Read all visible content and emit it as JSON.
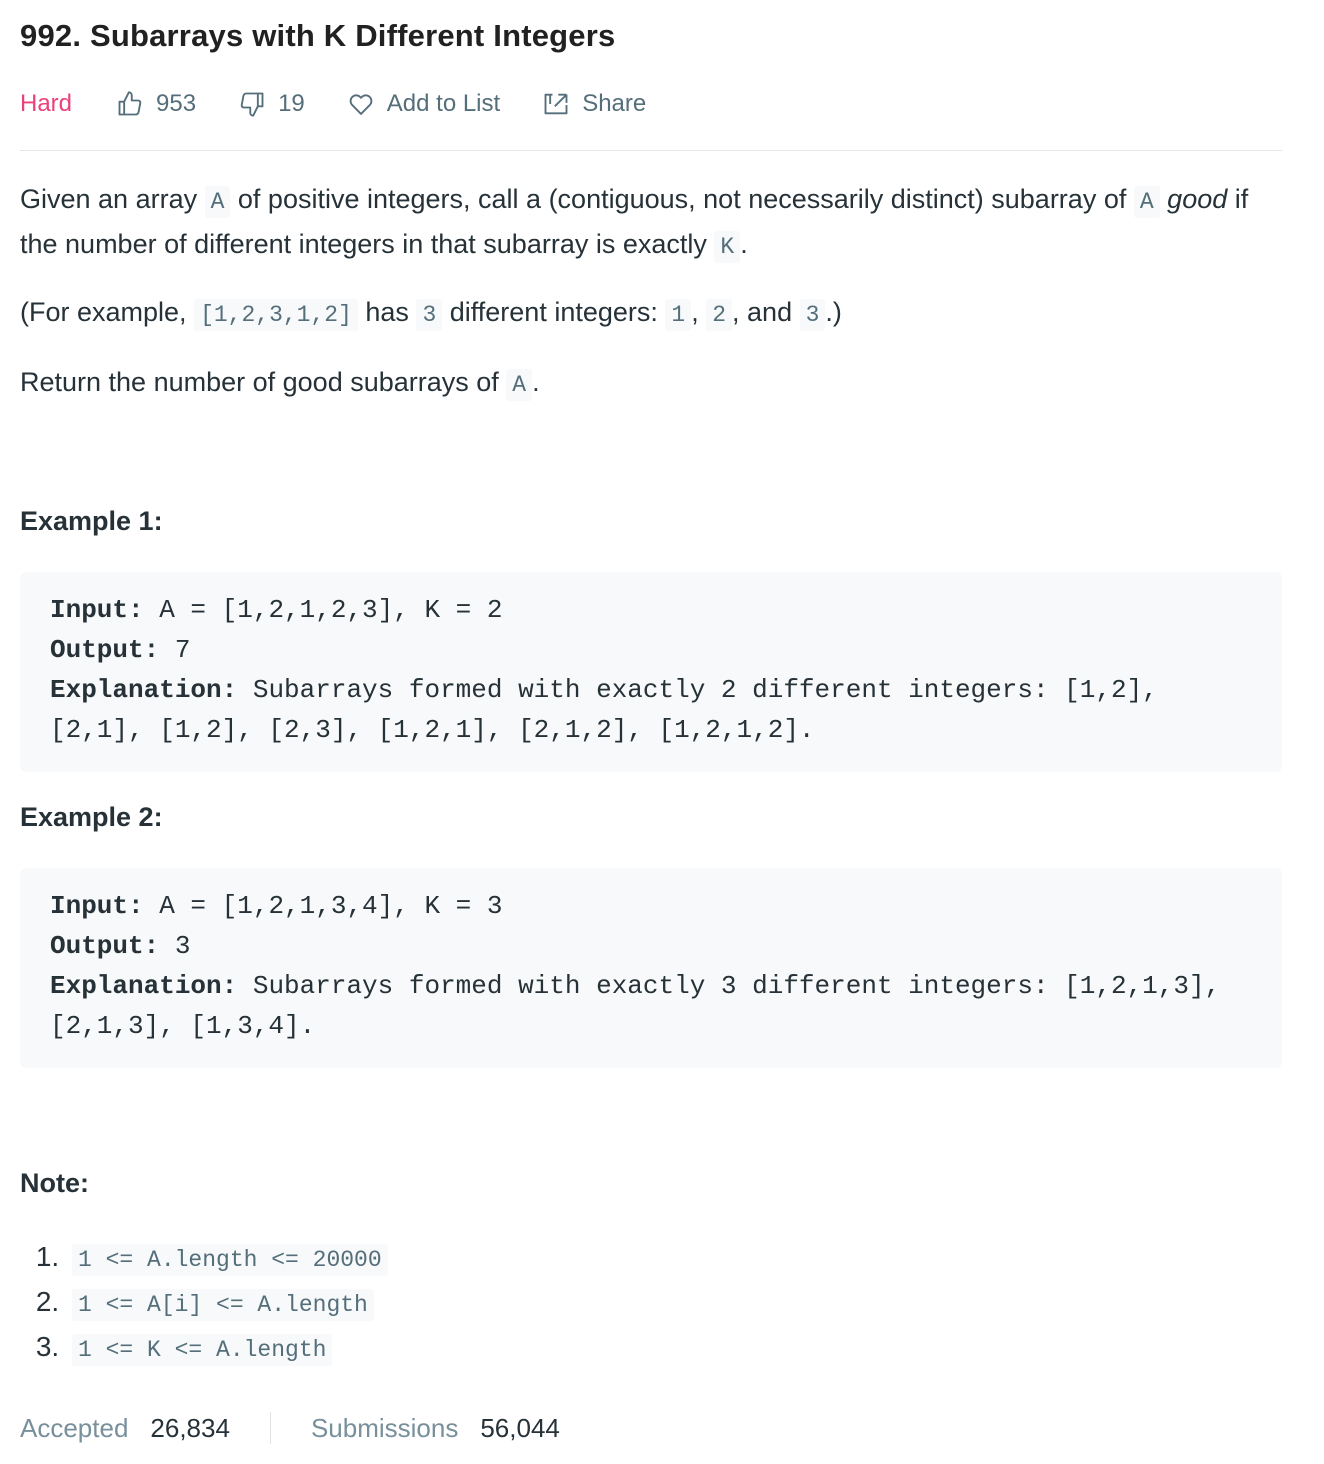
{
  "problem": {
    "title": "992. Subarrays with K Different Integers",
    "difficulty": "Hard",
    "likes": "953",
    "dislikes": "19",
    "add_to_list": "Add to List",
    "share": "Share"
  },
  "description": {
    "p1_a": "Given an array ",
    "p1_code_a": "A",
    "p1_b": " of positive integers, call a (contiguous, not necessarily distinct) subarray of ",
    "p1_code_a2": "A",
    "p1_em": "good",
    "p1_c": " if the number of different integers in that subarray is exactly ",
    "p1_code_k": "K",
    "p1_d": ".",
    "p2_a": "(For example, ",
    "p2_code_arr": "[1,2,3,1,2]",
    "p2_b": " has ",
    "p2_code_3": "3",
    "p2_c": " different integers: ",
    "p2_code_1": "1",
    "p2_d": ", ",
    "p2_code_2": "2",
    "p2_e": ", and ",
    "p2_code_3b": "3",
    "p2_f": ".)",
    "p3_a": "Return the number of good subarrays of ",
    "p3_code_a": "A",
    "p3_b": "."
  },
  "examples": [
    {
      "heading": "Example 1:",
      "input_label": "Input:",
      "input": " A = [1,2,1,2,3], K = 2",
      "output_label": "Output:",
      "output": " 7",
      "explanation_label": "Explanation:",
      "explanation_line1": " Subarrays formed with exactly 2 different integers: [1,2],",
      "explanation_line2": "[2,1], [1,2], [2,3], [1,2,1], [2,1,2], [1,2,1,2]."
    },
    {
      "heading": "Example 2:",
      "input_label": "Input:",
      "input": " A = [1,2,1,3,4], K = 3",
      "output_label": "Output:",
      "output": " 3",
      "explanation_label": "Explanation:",
      "explanation_line1": " Subarrays formed with exactly 3 different integers: [1,2,1,3],",
      "explanation_line2": "[2,1,3], [1,3,4]."
    }
  ],
  "note": {
    "heading": "Note:",
    "items": [
      "1 <= A.length <= 20000",
      "1 <= A[i] <= A.length",
      "1 <= K <= A.length"
    ]
  },
  "stats": {
    "accepted_label": "Accepted",
    "accepted_value": "26,834",
    "submissions_label": "Submissions",
    "submissions_value": "56,044"
  },
  "colors": {
    "difficulty_hard": "#ec407a",
    "meta_text": "#546e7a",
    "code_bg": "#f7f9fa"
  },
  "icons": [
    "thumbs-up-icon",
    "thumbs-down-icon",
    "heart-icon",
    "share-icon"
  ]
}
